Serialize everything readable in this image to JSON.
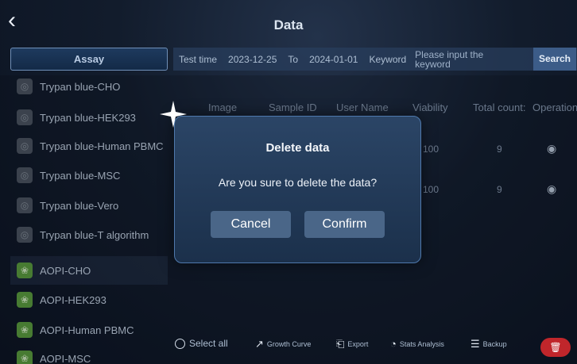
{
  "header": {
    "back_icon": "chevron-left-icon",
    "title": "Data"
  },
  "sidebar": {
    "header": "Assay",
    "items": [
      {
        "label": "Trypan blue-CHO",
        "icon": "trypan-blue-icon",
        "kind": "tb"
      },
      {
        "label": "Trypan blue-HEK293",
        "icon": "trypan-blue-icon",
        "kind": "tb"
      },
      {
        "label": "Trypan blue-Human PBMC",
        "icon": "trypan-blue-icon",
        "kind": "tb"
      },
      {
        "label": "Trypan blue-MSC",
        "icon": "trypan-blue-icon",
        "kind": "tb"
      },
      {
        "label": "Trypan blue-Vero",
        "icon": "trypan-blue-icon",
        "kind": "tb"
      },
      {
        "label": "Trypan blue-T algorithm",
        "icon": "trypan-blue-icon",
        "kind": "tb"
      },
      {
        "label": "AOPI-CHO",
        "icon": "aopi-icon",
        "kind": "ao",
        "active": true
      },
      {
        "label": "AOPI-HEK293",
        "icon": "aopi-icon",
        "kind": "ao"
      },
      {
        "label": "AOPI-Human PBMC",
        "icon": "aopi-icon",
        "kind": "ao"
      },
      {
        "label": "AOPI-MSC",
        "icon": "aopi-icon",
        "kind": "ao"
      }
    ]
  },
  "filter": {
    "test_time_label": "Test time",
    "start_date": "2023-12-25",
    "to_label": "To",
    "end_date": "2024-01-01",
    "keyword_label": "Keyword",
    "keyword_placeholder": "Please input the keyword",
    "search_label": "Search"
  },
  "table": {
    "headers": [
      "Image",
      "Sample ID",
      "User Name",
      "Viability",
      "Total count:",
      "Operation"
    ],
    "rows": [
      {
        "viability": "100",
        "total_count": "9",
        "operation_icon": "eye-icon"
      },
      {
        "viability": "100",
        "total_count": "9",
        "operation_icon": "eye-icon"
      }
    ]
  },
  "dialog": {
    "title": "Delete data",
    "message": "Are you sure to delete the data?",
    "cancel_label": "Cancel",
    "confirm_label": "Confirm"
  },
  "bottom_bar": {
    "select_all": "Select all",
    "growth_curve": "Growth Curve",
    "export": "Export",
    "stats_analysis": "Stats Analysis",
    "backup": "Backup",
    "delete_icon": "trash-icon"
  },
  "colors": {
    "background": "#121c2c",
    "dialog_border": "#4f79ad",
    "button": "#4a6688",
    "search_button": "#3c5c88",
    "delete_button": "#c0262b",
    "aopi_icon": "#5da13c"
  }
}
